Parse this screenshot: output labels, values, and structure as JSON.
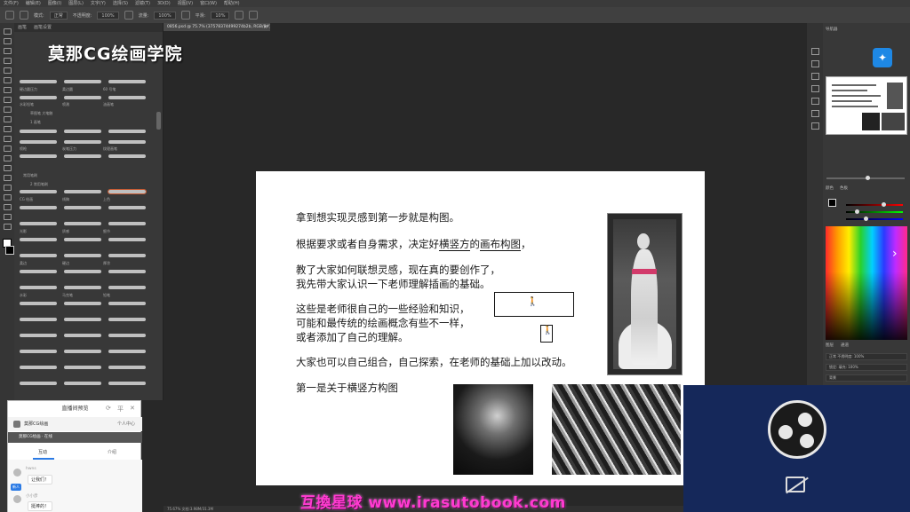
{
  "app": {
    "doc_tab": "0856.psd @ 75.7% (37578374499274b2b, RGB/8#) *",
    "close_glyph": "×",
    "status": "75.67%    文档:3.98M/31.3M"
  },
  "optionbar": {
    "mode_label": "模式:",
    "mode_value": "正常",
    "opacity_label": "不透明度:",
    "opacity_value": "100%",
    "flow_label": "流量:",
    "flow_value": "100%",
    "smooth_label": "平滑:",
    "smooth_value": "10%"
  },
  "menubar": {
    "items": [
      "文件(F)",
      "编辑(E)",
      "图像(I)",
      "图层(L)",
      "文字(Y)",
      "选择(S)",
      "滤镜(T)",
      "3D(D)",
      "视图(V)",
      "窗口(W)",
      "帮助(H)"
    ]
  },
  "brushpanel": {
    "tabs": [
      "画笔",
      "画笔设置"
    ],
    "labels": [
      "硬边圆压力",
      "柔边圆",
      "60 号笔",
      "水彩铅笔",
      "喷溅",
      "油画笔",
      "草图笔 大笔触",
      "喷枪",
      "炭笔压力",
      "纹理画笔",
      "常用笔刷",
      "CG 绘画",
      "线稿",
      "上色",
      "光影",
      "质感",
      "细节",
      "柔边",
      "硬边",
      "厚涂",
      "水彩",
      "马克笔",
      "铅笔"
    ],
    "group_labels": [
      "1 画笔",
      "2 常用笔刷"
    ]
  },
  "watermark_top": "莫那CG绘画学院",
  "document": {
    "lines": [
      "拿到想实现灵感到第一步就是构图。",
      "根据要求或者自身需求，决定好",
      "横竖方",
      "的",
      "画布构图",
      "，",
      "教了大家如何联想灵感，现在真的要创作了，",
      "我先带大家认识一下老师理解插画的基础。",
      "这些是老师很自己的一些经验和知识，",
      "可能和最传统的绘画概念有些不一样，",
      "或者添加了自己的理解。",
      "大家也可以自己组合，自己探索，在老师的基础上加以改动。",
      "第一是关于横竖方构图"
    ],
    "sketch_glyph": "🚶",
    "sketch2_glyph": "🚶"
  },
  "right_panels": {
    "navigator_tab": "导航器",
    "ps_logo_glyph": "✦",
    "color_tabs": [
      "颜色",
      "色板"
    ],
    "layers_tabs": [
      "图层",
      "通道"
    ],
    "layer_rows": [
      "正常   不透明度: 100%",
      "锁定:   填充: 100%",
      "背景"
    ]
  },
  "chat": {
    "title": "直播间预览",
    "minimize": "⟳",
    "pin": "平",
    "close": "✕",
    "room_name": "莫那CG绘画",
    "room_right": "个人中心",
    "live_bar": "莫那CG绘画 · 在线",
    "tab_active": "互动",
    "tab_other": "介绍",
    "msg1_name": "hwns",
    "msg1_text": "让我们！",
    "msg1_badge": "新人",
    "msg2_name": "小小彦",
    "msg2_text": "挺棒的！"
  },
  "watermark_bottom": "互換星球 www.irasutobook.com"
}
